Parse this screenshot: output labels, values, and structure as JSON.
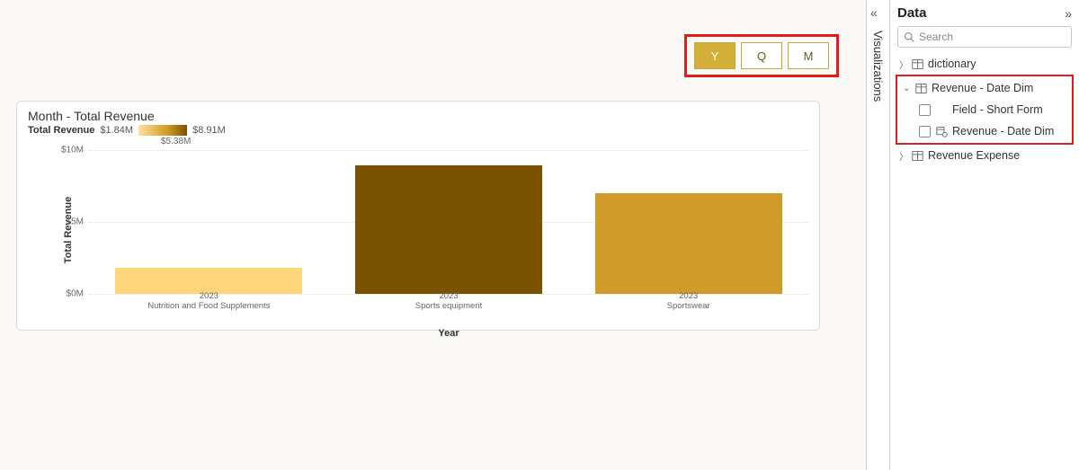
{
  "slicer": {
    "options": [
      "Y",
      "Q",
      "M"
    ],
    "active": "Y"
  },
  "chart": {
    "title": "Month - Total Revenue",
    "legend_label": "Total Revenue",
    "legend_min": "$1.84M",
    "legend_mid": "$5.38M",
    "legend_max": "$8.91M",
    "y_label": "Total Revenue",
    "x_label": "Year",
    "y_ticks": [
      "$10M",
      "$5M",
      "$0M"
    ]
  },
  "chart_data": {
    "type": "bar",
    "categories": [
      {
        "year": "2023",
        "name": "Nutrition and Food Supplements"
      },
      {
        "year": "2023",
        "name": "Sports equipment"
      },
      {
        "year": "2023",
        "name": "Sportswear"
      }
    ],
    "values": [
      1.84,
      8.91,
      7.0
    ],
    "colors": [
      "#ffd57a",
      "#7a5200",
      "#cf9b2a"
    ],
    "ylabel": "Total Revenue",
    "xlabel": "Year",
    "ylim": [
      0,
      10
    ],
    "unit": "$M",
    "gradient_scale": {
      "min": 1.84,
      "mid": 5.38,
      "max": 8.91
    }
  },
  "panes": {
    "viz_label": "Visualizations",
    "data_title": "Data",
    "search_placeholder": "Search"
  },
  "tree": {
    "item0": "dictionary",
    "item1": "Revenue - Date Dim",
    "item1a": "Field - Short Form",
    "item1b": "Revenue - Date Dim",
    "item2": "Revenue Expense"
  }
}
